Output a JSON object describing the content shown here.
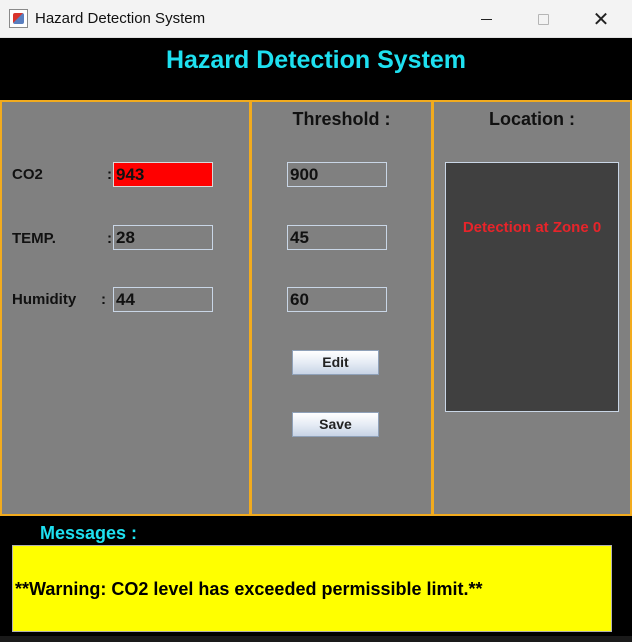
{
  "window": {
    "title": "Hazard Detection System",
    "close_glyph": "✕"
  },
  "header": {
    "title": "Hazard Detection System",
    "color": "#1ee0f0"
  },
  "readings": {
    "colon": ":",
    "co2": {
      "label": "CO2",
      "value": "943",
      "alert": true
    },
    "temp": {
      "label": "TEMP.",
      "value": "28",
      "alert": false
    },
    "humidity": {
      "label": "Humidity",
      "value": "44",
      "alert": false
    }
  },
  "threshold": {
    "heading": "Threshold :",
    "co2": "900",
    "temp": "45",
    "humidity": "60",
    "edit_label": "Edit",
    "save_label": "Save"
  },
  "location": {
    "heading": "Location :",
    "detection": "Detection at Zone 0",
    "detection_color": "#e8242a"
  },
  "messages": {
    "heading": "Messages :",
    "text": "**Warning: CO2 level has exceeded permissible limit.**",
    "background": "#ffff00"
  },
  "colors": {
    "panel_border": "#f2ab1e",
    "panel_bg": "#808080",
    "alert_field": "#ff0000"
  },
  "icons": {
    "app": "app-icon",
    "minimize": "minimize-icon",
    "maximize": "maximize-icon",
    "close": "close-icon"
  }
}
